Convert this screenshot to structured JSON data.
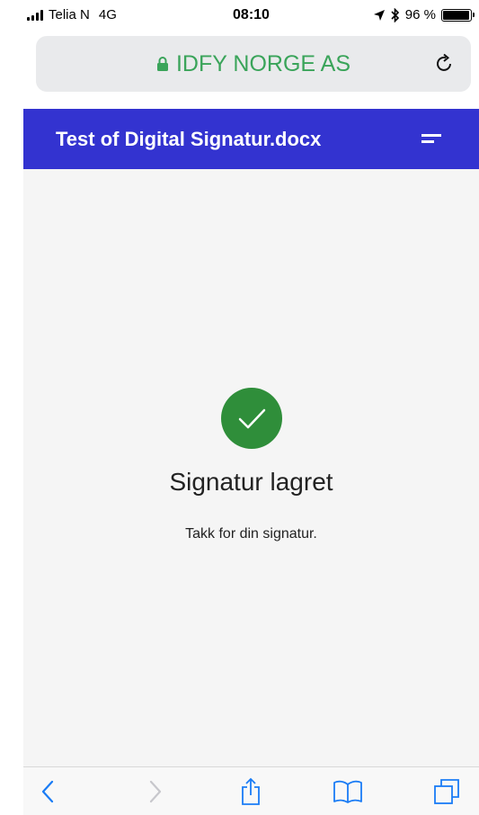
{
  "status_bar": {
    "carrier": "Telia N",
    "network": "4G",
    "time": "08:10",
    "battery": "96 %",
    "battery_level": 0.96
  },
  "browser": {
    "site_name": "IDFY NORGE AS",
    "lock_color": "#3aa45a"
  },
  "header": {
    "title": "Test of Digital Signatur.docx",
    "background": "#3333d0"
  },
  "confirmation": {
    "title": "Signatur lagret",
    "message": "Takk for din signatur.",
    "accent": "#2f8e3a"
  },
  "toolbar": {
    "icons": [
      "back-icon",
      "forward-icon",
      "share-icon",
      "bookmarks-icon",
      "tabs-icon"
    ],
    "accent": "#1a7cf5"
  }
}
